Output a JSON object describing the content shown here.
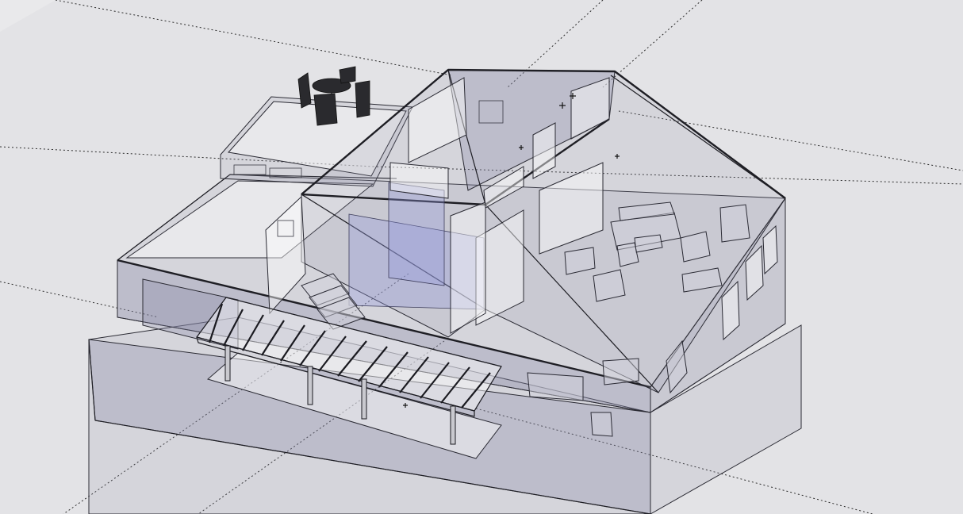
{
  "viewport": {
    "background": "#e9e9eb",
    "ground_color": "#dcdcdf",
    "edge_color": "#1e1e24",
    "glass_color": "#9696aa",
    "accent_blue": "#969bdc"
  },
  "icons": {
    "guide_point": "crosshair-icon"
  }
}
